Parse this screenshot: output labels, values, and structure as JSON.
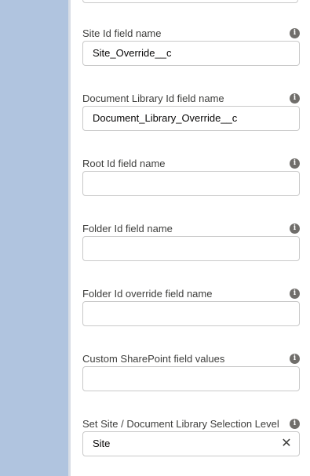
{
  "fields": [
    {
      "label": "Site Id field name",
      "value": "Site_Override__c",
      "placeholder": ""
    },
    {
      "label": "Document Library Id field name",
      "value": "Document_Library_Override__c",
      "placeholder": ""
    },
    {
      "label": "Root Id field name",
      "value": "",
      "placeholder": ""
    },
    {
      "label": "Folder Id field name",
      "value": "",
      "placeholder": ""
    },
    {
      "label": "Folder Id override field name",
      "value": "",
      "placeholder": ""
    },
    {
      "label": "Custom SharePoint field values",
      "value": "",
      "placeholder": ""
    }
  ],
  "selection_level": {
    "label": "Set Site / Document Library Selection Level",
    "value": "Site",
    "clear_glyph": "✕"
  },
  "icons": {
    "info": "info-icon",
    "info_glyph": "i",
    "clear": "close-icon"
  },
  "colors": {
    "left_rail": "#b0c4df",
    "label_text": "#3e3e3c",
    "input_border": "#c9c9c9",
    "info_icon": "#706e6b"
  }
}
